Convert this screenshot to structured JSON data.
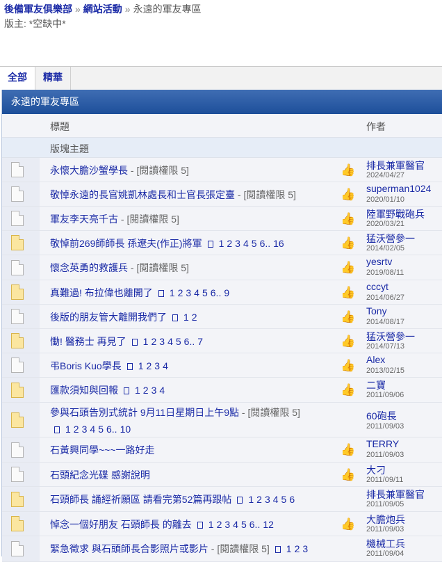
{
  "breadcrumb": {
    "home": "後備軍友俱樂部",
    "section": "網站活動",
    "current": "永遠的軍友專區"
  },
  "moderator": "版主: *空缺中*",
  "tabs": [
    {
      "label": "全部"
    },
    {
      "label": "精華"
    }
  ],
  "board": {
    "title": "永遠的軍友專區",
    "col_title": "標題",
    "col_author": "作者",
    "section_label": "版塊主題"
  },
  "icons": {
    "topic": "document-icon",
    "hot_topic": "hot-document-icon",
    "rating": "thumbs-up-icon"
  },
  "colors": {
    "link": "#1a2aa6",
    "header": "#1d4f9a",
    "row": "#f3f4f8"
  },
  "topics": [
    {
      "title": "永懷大膽沙蟹學長",
      "perm": " - [閱讀權限 5]",
      "pages": [],
      "hot": false,
      "rated": true,
      "author": "排長兼軍醫官",
      "date": "2024/04/27"
    },
    {
      "title": "敬悼永遠的長官姚凱林處長和士官長張定臺",
      "perm": " - [閱讀權限 5]",
      "pages": [],
      "hot": false,
      "rated": true,
      "author": "superman1024",
      "date": "2020/01/10"
    },
    {
      "title": "軍友李天亮千古",
      "perm": " - [閱讀權限 5]",
      "pages": [],
      "hot": false,
      "rated": true,
      "author": "陸軍野戰砲兵",
      "date": "2020/03/21"
    },
    {
      "title": "敬悼前269師師長 孫遼夫(作正)將軍",
      "perm": "",
      "pages": [
        "1",
        "2",
        "3",
        "4",
        "5",
        "6..",
        "16"
      ],
      "hot": true,
      "rated": true,
      "author": "猛沃營參一",
      "date": "2014/02/05"
    },
    {
      "title": "懷念英勇的救護兵",
      "perm": " - [閱讀權限 5]",
      "pages": [],
      "hot": false,
      "rated": true,
      "author": "yesrtv",
      "date": "2019/08/11"
    },
    {
      "title": "真難過! 布拉偉也離開了",
      "perm": "",
      "pages": [
        "1",
        "2",
        "3",
        "4",
        "5",
        "6..",
        "9"
      ],
      "hot": true,
      "rated": true,
      "author": "cccyt",
      "date": "2014/06/27"
    },
    {
      "title": "後版的朋友管大離開我們了",
      "perm": "",
      "pages": [
        "1",
        "2"
      ],
      "hot": false,
      "rated": true,
      "author": "Tony",
      "date": "2014/08/17"
    },
    {
      "title": "慟! 醫務士 再見了",
      "perm": "",
      "pages": [
        "1",
        "2",
        "3",
        "4",
        "5",
        "6..",
        "7"
      ],
      "hot": true,
      "rated": true,
      "author": "猛沃營參一",
      "date": "2014/07/13"
    },
    {
      "title": "弔Boris Kuo學長",
      "perm": "",
      "pages": [
        "1",
        "2",
        "3",
        "4"
      ],
      "hot": false,
      "rated": true,
      "author": "Alex",
      "date": "2013/02/15"
    },
    {
      "title": "匯款須知與回報",
      "perm": "",
      "pages": [
        "1",
        "2",
        "3",
        "4"
      ],
      "hot": true,
      "rated": true,
      "author": "二寶",
      "date": "2011/09/06"
    },
    {
      "title": "參與石頭告別式統計 9月11日星期日上午9點",
      "perm": " - [閱讀權限 5]",
      "pages": [
        "1",
        "2",
        "3",
        "4",
        "5",
        "6..",
        "10"
      ],
      "hot": true,
      "rated": false,
      "author": "60砲長",
      "date": "2011/09/03"
    },
    {
      "title": "石黃興同學~~~一路好走",
      "perm": "",
      "pages": [],
      "hot": false,
      "rated": true,
      "author": "TERRY",
      "date": "2011/09/03"
    },
    {
      "title": "石頭紀念光碟 感謝說明",
      "perm": "",
      "pages": [],
      "hot": false,
      "rated": true,
      "author": "大刁",
      "date": "2011/09/11"
    },
    {
      "title": "石頭師長 誦經祈願區 請看完第52篇再跟帖",
      "perm": "",
      "pages": [
        "1",
        "2",
        "3",
        "4",
        "5",
        "6"
      ],
      "hot": true,
      "rated": false,
      "author": "排長兼軍醫官",
      "date": "2011/09/05"
    },
    {
      "title": "悼念一個好朋友 石頭師長 的離去",
      "perm": "",
      "pages": [
        "1",
        "2",
        "3",
        "4",
        "5",
        "6..",
        "12"
      ],
      "hot": true,
      "rated": true,
      "author": "大膽炮兵",
      "date": "2011/09/03"
    },
    {
      "title": "緊急徵求 與石頭師長合影照片或影片",
      "perm": " - [閱讀權限 5]",
      "pages": [
        "1",
        "2",
        "3"
      ],
      "hot": false,
      "rated": false,
      "author": "機械工兵",
      "date": "2011/09/04"
    }
  ]
}
